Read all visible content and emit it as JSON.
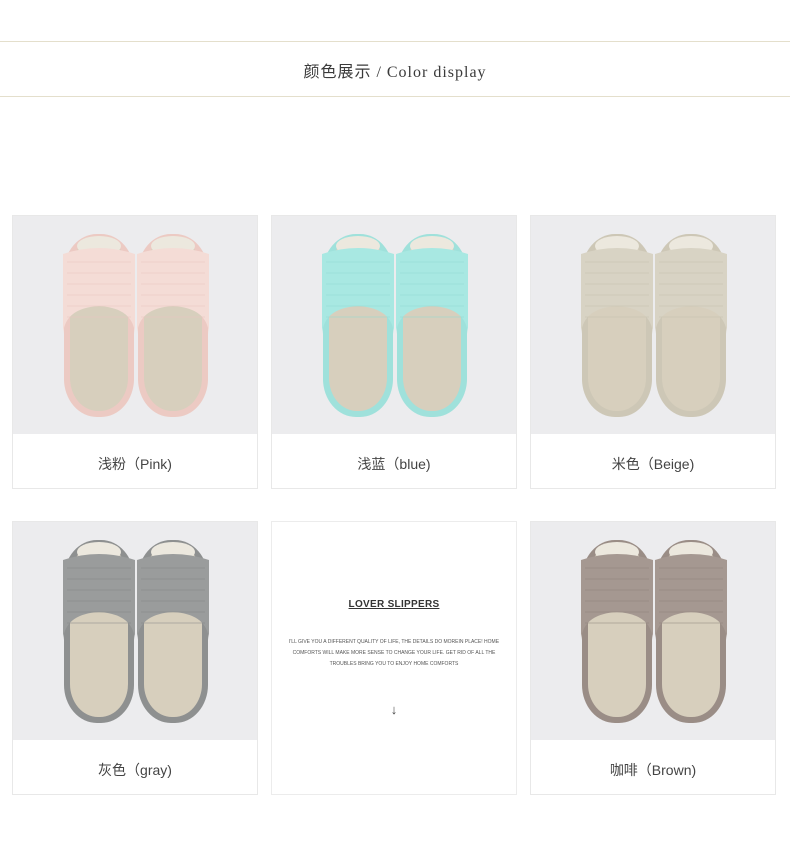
{
  "header": {
    "title": "颜色展示 / Color display"
  },
  "products": [
    {
      "label": "浅粉（Pink)",
      "upper": "#f4dcd6",
      "upper_dark": "#e9c6bf",
      "trim": "#eccac3"
    },
    {
      "label": "浅蓝（blue)",
      "upper": "#a8e8e2",
      "upper_dark": "#8fd9d2",
      "trim": "#9fe1db"
    },
    {
      "label": "米色（Beige)",
      "upper": "#d8d3c4",
      "upper_dark": "#c6c0ae",
      "trim": "#cdc7b6"
    },
    {
      "label": "灰色（gray)",
      "upper": "#9a9c9c",
      "upper_dark": "#858787",
      "trim": "#8e9090"
    },
    {
      "label": "咖啡（Brown)",
      "upper": "#a59891",
      "upper_dark": "#8f827b",
      "trim": "#9a8d86"
    }
  ],
  "promo": {
    "title": "LOVER SLIPPERS",
    "body": "I'LL GIVE YOU A DIFFERENT QUALITY OF LIFE, THE DETAILS DO MOREIN PLACE! HOME COMFORTS WILL MAKE MORE SENSE TO CHANGE YOUR LIFE. GET RID OF ALL THE TROUBLES BRING YOU TO ENJOY HOME COMFORTS",
    "arrow": "↓"
  },
  "colors": {
    "rule": "#e4dfcc",
    "photo_bg": "#ececee",
    "insole": "#d7cfbd",
    "insole_toe": "#ece8de"
  }
}
